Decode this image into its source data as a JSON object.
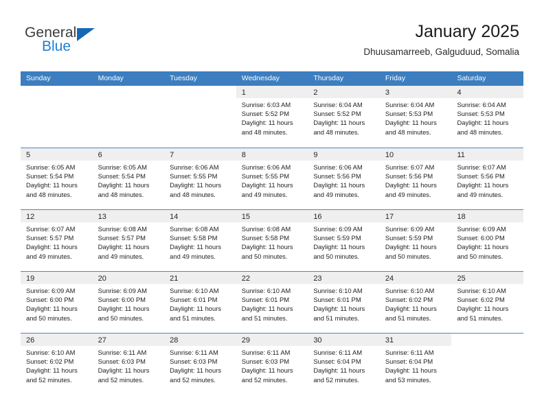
{
  "brand": {
    "name_part1": "General",
    "name_part2": "Blue",
    "triangle_icon": "triangle-icon",
    "accent_color": "#1c7fd4",
    "triangle_color": "#1668b5"
  },
  "header": {
    "title": "January 2025",
    "subtitle": "Dhuusamarreeb, Galguduud, Somalia"
  },
  "theme": {
    "header_row_bg": "#3c7ebf",
    "row_divider": "#4a86c4",
    "daynum_band_bg": "#efefef",
    "text_color": "#1e1e1e"
  },
  "weekdays": [
    "Sunday",
    "Monday",
    "Tuesday",
    "Wednesday",
    "Thursday",
    "Friday",
    "Saturday"
  ],
  "weeks": [
    [
      {
        "day": "",
        "lines": []
      },
      {
        "day": "",
        "lines": []
      },
      {
        "day": "",
        "lines": []
      },
      {
        "day": "1",
        "lines": [
          "Sunrise: 6:03 AM",
          "Sunset: 5:52 PM",
          "Daylight: 11 hours",
          "and 48 minutes."
        ]
      },
      {
        "day": "2",
        "lines": [
          "Sunrise: 6:04 AM",
          "Sunset: 5:52 PM",
          "Daylight: 11 hours",
          "and 48 minutes."
        ]
      },
      {
        "day": "3",
        "lines": [
          "Sunrise: 6:04 AM",
          "Sunset: 5:53 PM",
          "Daylight: 11 hours",
          "and 48 minutes."
        ]
      },
      {
        "day": "4",
        "lines": [
          "Sunrise: 6:04 AM",
          "Sunset: 5:53 PM",
          "Daylight: 11 hours",
          "and 48 minutes."
        ]
      }
    ],
    [
      {
        "day": "5",
        "lines": [
          "Sunrise: 6:05 AM",
          "Sunset: 5:54 PM",
          "Daylight: 11 hours",
          "and 48 minutes."
        ]
      },
      {
        "day": "6",
        "lines": [
          "Sunrise: 6:05 AM",
          "Sunset: 5:54 PM",
          "Daylight: 11 hours",
          "and 48 minutes."
        ]
      },
      {
        "day": "7",
        "lines": [
          "Sunrise: 6:06 AM",
          "Sunset: 5:55 PM",
          "Daylight: 11 hours",
          "and 48 minutes."
        ]
      },
      {
        "day": "8",
        "lines": [
          "Sunrise: 6:06 AM",
          "Sunset: 5:55 PM",
          "Daylight: 11 hours",
          "and 49 minutes."
        ]
      },
      {
        "day": "9",
        "lines": [
          "Sunrise: 6:06 AM",
          "Sunset: 5:56 PM",
          "Daylight: 11 hours",
          "and 49 minutes."
        ]
      },
      {
        "day": "10",
        "lines": [
          "Sunrise: 6:07 AM",
          "Sunset: 5:56 PM",
          "Daylight: 11 hours",
          "and 49 minutes."
        ]
      },
      {
        "day": "11",
        "lines": [
          "Sunrise: 6:07 AM",
          "Sunset: 5:56 PM",
          "Daylight: 11 hours",
          "and 49 minutes."
        ]
      }
    ],
    [
      {
        "day": "12",
        "lines": [
          "Sunrise: 6:07 AM",
          "Sunset: 5:57 PM",
          "Daylight: 11 hours",
          "and 49 minutes."
        ]
      },
      {
        "day": "13",
        "lines": [
          "Sunrise: 6:08 AM",
          "Sunset: 5:57 PM",
          "Daylight: 11 hours",
          "and 49 minutes."
        ]
      },
      {
        "day": "14",
        "lines": [
          "Sunrise: 6:08 AM",
          "Sunset: 5:58 PM",
          "Daylight: 11 hours",
          "and 49 minutes."
        ]
      },
      {
        "day": "15",
        "lines": [
          "Sunrise: 6:08 AM",
          "Sunset: 5:58 PM",
          "Daylight: 11 hours",
          "and 50 minutes."
        ]
      },
      {
        "day": "16",
        "lines": [
          "Sunrise: 6:09 AM",
          "Sunset: 5:59 PM",
          "Daylight: 11 hours",
          "and 50 minutes."
        ]
      },
      {
        "day": "17",
        "lines": [
          "Sunrise: 6:09 AM",
          "Sunset: 5:59 PM",
          "Daylight: 11 hours",
          "and 50 minutes."
        ]
      },
      {
        "day": "18",
        "lines": [
          "Sunrise: 6:09 AM",
          "Sunset: 6:00 PM",
          "Daylight: 11 hours",
          "and 50 minutes."
        ]
      }
    ],
    [
      {
        "day": "19",
        "lines": [
          "Sunrise: 6:09 AM",
          "Sunset: 6:00 PM",
          "Daylight: 11 hours",
          "and 50 minutes."
        ]
      },
      {
        "day": "20",
        "lines": [
          "Sunrise: 6:09 AM",
          "Sunset: 6:00 PM",
          "Daylight: 11 hours",
          "and 50 minutes."
        ]
      },
      {
        "day": "21",
        "lines": [
          "Sunrise: 6:10 AM",
          "Sunset: 6:01 PM",
          "Daylight: 11 hours",
          "and 51 minutes."
        ]
      },
      {
        "day": "22",
        "lines": [
          "Sunrise: 6:10 AM",
          "Sunset: 6:01 PM",
          "Daylight: 11 hours",
          "and 51 minutes."
        ]
      },
      {
        "day": "23",
        "lines": [
          "Sunrise: 6:10 AM",
          "Sunset: 6:01 PM",
          "Daylight: 11 hours",
          "and 51 minutes."
        ]
      },
      {
        "day": "24",
        "lines": [
          "Sunrise: 6:10 AM",
          "Sunset: 6:02 PM",
          "Daylight: 11 hours",
          "and 51 minutes."
        ]
      },
      {
        "day": "25",
        "lines": [
          "Sunrise: 6:10 AM",
          "Sunset: 6:02 PM",
          "Daylight: 11 hours",
          "and 51 minutes."
        ]
      }
    ],
    [
      {
        "day": "26",
        "lines": [
          "Sunrise: 6:10 AM",
          "Sunset: 6:02 PM",
          "Daylight: 11 hours",
          "and 52 minutes."
        ]
      },
      {
        "day": "27",
        "lines": [
          "Sunrise: 6:11 AM",
          "Sunset: 6:03 PM",
          "Daylight: 11 hours",
          "and 52 minutes."
        ]
      },
      {
        "day": "28",
        "lines": [
          "Sunrise: 6:11 AM",
          "Sunset: 6:03 PM",
          "Daylight: 11 hours",
          "and 52 minutes."
        ]
      },
      {
        "day": "29",
        "lines": [
          "Sunrise: 6:11 AM",
          "Sunset: 6:03 PM",
          "Daylight: 11 hours",
          "and 52 minutes."
        ]
      },
      {
        "day": "30",
        "lines": [
          "Sunrise: 6:11 AM",
          "Sunset: 6:04 PM",
          "Daylight: 11 hours",
          "and 52 minutes."
        ]
      },
      {
        "day": "31",
        "lines": [
          "Sunrise: 6:11 AM",
          "Sunset: 6:04 PM",
          "Daylight: 11 hours",
          "and 53 minutes."
        ]
      },
      {
        "day": "",
        "lines": []
      }
    ]
  ]
}
